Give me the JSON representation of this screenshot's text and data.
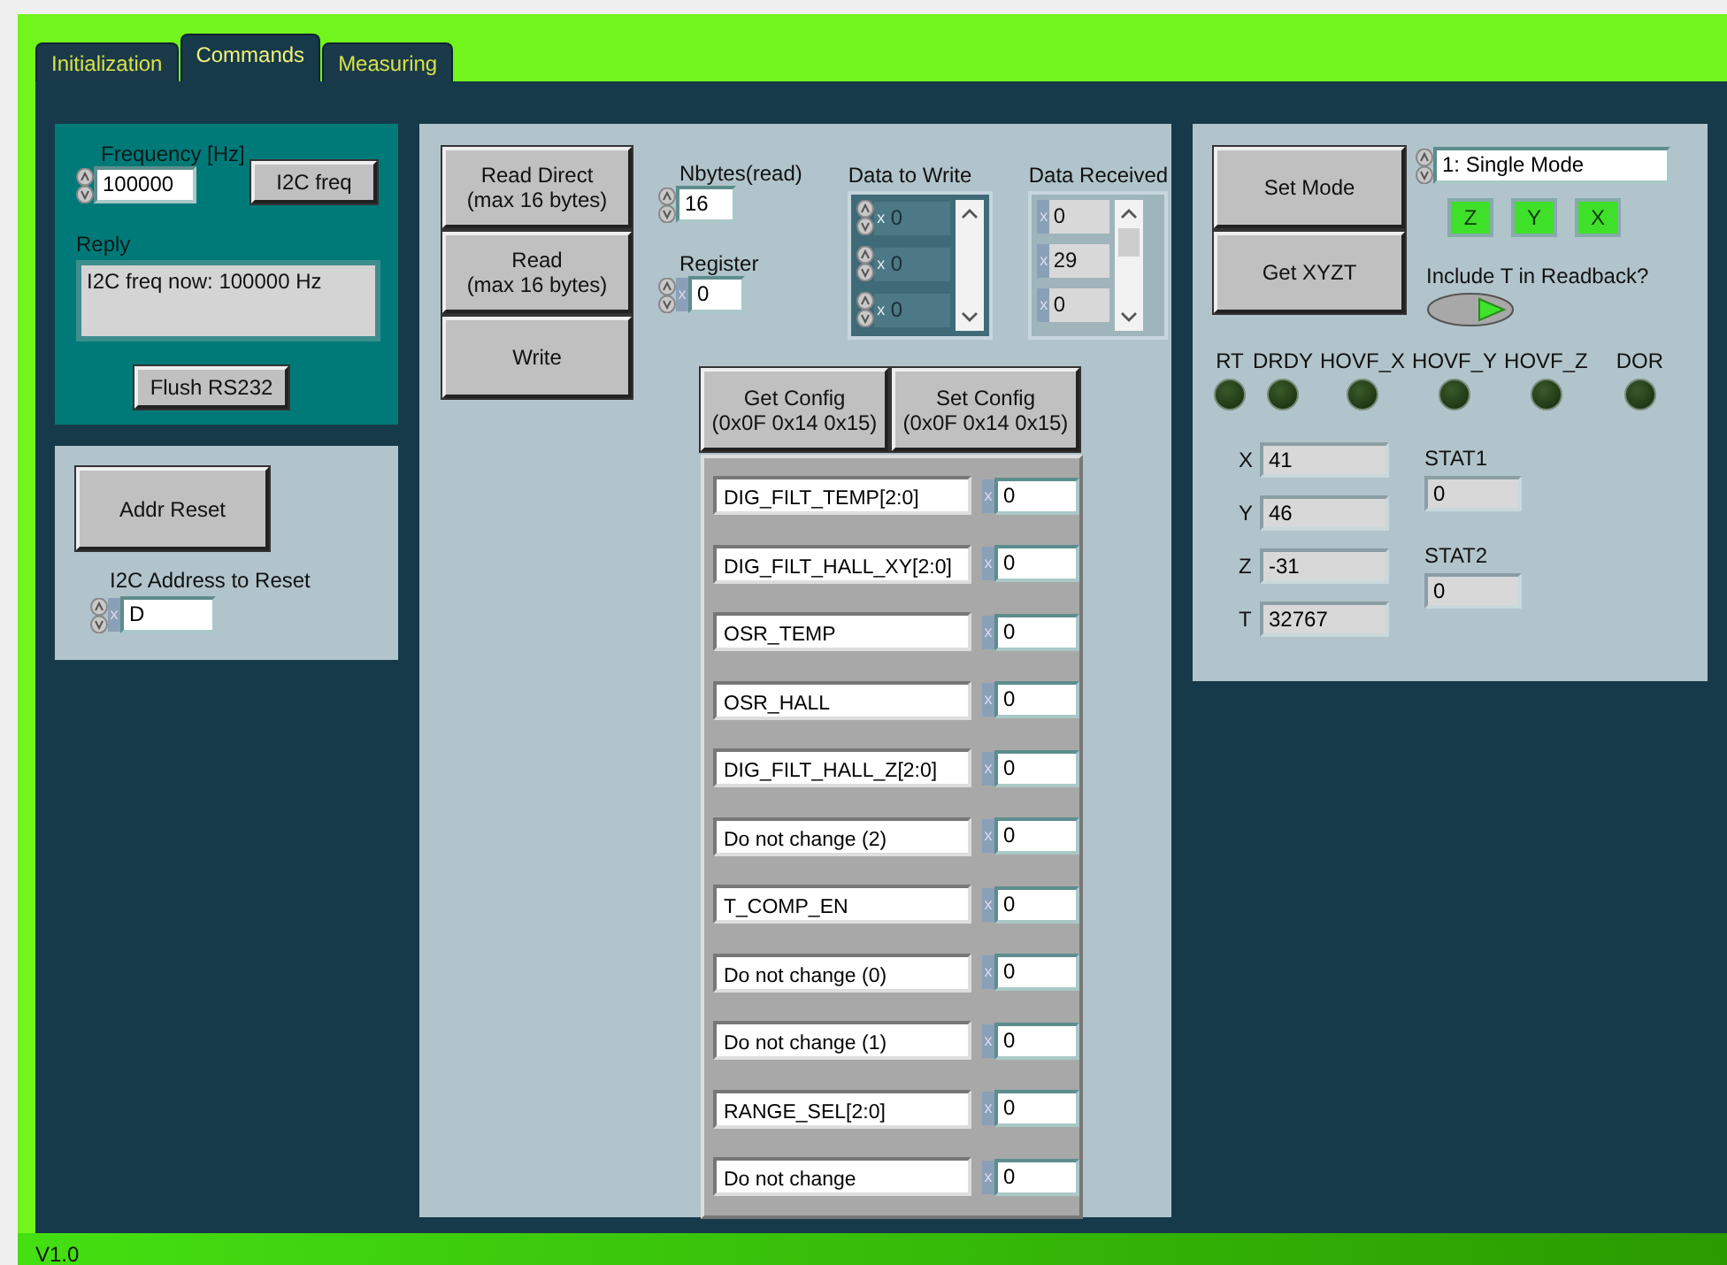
{
  "tabs": [
    {
      "label": "Initialization",
      "selected": false
    },
    {
      "label": "Commands",
      "selected": true
    },
    {
      "label": "Measuring",
      "selected": false
    }
  ],
  "i2c_panel": {
    "frequency_label": "Frequency [Hz]",
    "frequency": "100000",
    "freq_button": "I2C freq",
    "reply_label": "Reply",
    "reply": "I2C freq now: 100000 Hz",
    "flush_button": "Flush RS232"
  },
  "reset_panel": {
    "button": "Addr Reset",
    "address_label": "I2C Address to Reset",
    "radix": "x",
    "address": "D"
  },
  "rw_panel": {
    "buttons": [
      "Read Direct\n(max 16 bytes)",
      "Read\n(max 16 bytes)",
      "Write"
    ],
    "nbytes_label": "Nbytes(read)",
    "nbytes": "16",
    "register_label": "Register",
    "register_radix": "x",
    "register": "0",
    "data_to_write": {
      "label": "Data to Write",
      "disabled": true,
      "items": [
        {
          "radix": "x",
          "value": "0"
        },
        {
          "radix": "x",
          "value": "0"
        },
        {
          "radix": "x",
          "value": "0"
        }
      ]
    },
    "data_received": {
      "label": "Data Received",
      "disabled": false,
      "items": [
        {
          "radix": "x",
          "value": "0"
        },
        {
          "radix": "x",
          "value": "29"
        },
        {
          "radix": "x",
          "value": "0"
        }
      ]
    }
  },
  "config": {
    "buttons": [
      "Get Config\n(0x0F 0x14 0x15)",
      "Set Config\n(0x0F 0x14 0x15)"
    ],
    "registers": [
      {
        "name": "DIG_FILT_TEMP[2:0]",
        "radix": "x",
        "value": "0"
      },
      {
        "name": "DIG_FILT_HALL_XY[2:0]",
        "radix": "x",
        "value": "0"
      },
      {
        "name": "OSR_TEMP",
        "radix": "x",
        "value": "0"
      },
      {
        "name": "OSR_HALL",
        "radix": "x",
        "value": "0"
      },
      {
        "name": "DIG_FILT_HALL_Z[2:0]",
        "radix": "x",
        "value": "0"
      },
      {
        "name": "Do not change (2)",
        "radix": "x",
        "value": "0"
      },
      {
        "name": "T_COMP_EN",
        "radix": "x",
        "value": "0"
      },
      {
        "name": "Do not change (0)",
        "radix": "x",
        "value": "0"
      },
      {
        "name": "Do not change (1)",
        "radix": "x",
        "value": "0"
      },
      {
        "name": "RANGE_SEL[2:0]",
        "radix": "x",
        "value": "0"
      },
      {
        "name": "Do not change",
        "radix": "x",
        "value": "0"
      }
    ]
  },
  "measure_panel": {
    "buttons": [
      "Set Mode",
      "Get XYZT"
    ],
    "mode": "1: Single Mode",
    "axes": [
      {
        "label": "Z",
        "on": true
      },
      {
        "label": "Y",
        "on": true
      },
      {
        "label": "X",
        "on": true
      }
    ],
    "include_t_label": "Include T in Readback?",
    "include_t": true,
    "flags": [
      {
        "label": "RT",
        "on": false
      },
      {
        "label": "DRDY",
        "on": false
      },
      {
        "label": "HOVF_X",
        "on": false
      },
      {
        "label": "HOVF_Y",
        "on": false
      },
      {
        "label": "HOVF_Z",
        "on": false
      },
      {
        "label": "DOR",
        "on": false
      }
    ],
    "readings": [
      {
        "label": "X",
        "value": "41"
      },
      {
        "label": "Y",
        "value": "46"
      },
      {
        "label": "Z",
        "value": "-31"
      },
      {
        "label": "T",
        "value": "32767"
      }
    ],
    "status": [
      {
        "label": "STAT1",
        "value": "0"
      },
      {
        "label": "STAT2",
        "value": "0"
      }
    ]
  },
  "status_bar": {
    "version": "V1.0"
  }
}
